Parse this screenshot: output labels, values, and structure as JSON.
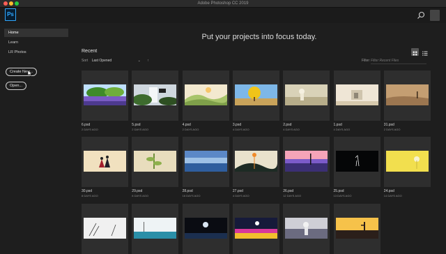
{
  "window": {
    "title": "Adobe Photoshop CC 2019",
    "traffic_lights": [
      "#fe5f57",
      "#febc2e",
      "#28c840"
    ]
  },
  "app": {
    "logo_text": "Ps",
    "accent": "#31a8ff"
  },
  "sidebar": {
    "items": [
      {
        "label": "Home",
        "active": true
      },
      {
        "label": "Learn"
      },
      {
        "label": "LR Photos"
      }
    ],
    "create_new": "Create New...",
    "open": "Open..."
  },
  "main": {
    "headline": "Put your projects into focus today.",
    "recent_title": "Recent",
    "sort_label": "Sort",
    "sort_value": "Last Opened",
    "filter_label": "Filter",
    "filter_placeholder": "Filter Recent Files"
  },
  "files": [
    {
      "name": "6.psd",
      "date": "2 DAYS AGO",
      "theme": "meadow"
    },
    {
      "name": "5.psd",
      "date": "2 DAYS AGO",
      "theme": "waterfall"
    },
    {
      "name": "4.psd",
      "date": "2 DAYS AGO",
      "theme": "hills"
    },
    {
      "name": "3.psd",
      "date": "4 DAYS AGO",
      "theme": "tree"
    },
    {
      "name": "2.psd",
      "date": "4 DAYS AGO",
      "theme": "figure"
    },
    {
      "name": "1.psd",
      "date": "4 DAYS AGO",
      "theme": "room"
    },
    {
      "name": "31.psd",
      "date": "2 DAYS AGO",
      "theme": "sepia"
    },
    {
      "name": "30.psd",
      "date": "8 DAYS AGO",
      "theme": "couple"
    },
    {
      "name": "29.psd",
      "date": "8 DAYS AGO",
      "theme": "plant"
    },
    {
      "name": "28.psd",
      "date": "16 DAYS AGO",
      "theme": "lake"
    },
    {
      "name": "27.psd",
      "date": "4 DAYS AGO",
      "theme": "moon"
    },
    {
      "name": "26.psd",
      "date": "12 DAYS AGO",
      "theme": "sunset"
    },
    {
      "name": "25.psd",
      "date": "13 DAYS AGO",
      "theme": "night"
    },
    {
      "name": "24.psd",
      "date": "14 DAYS AGO",
      "theme": "yellow"
    },
    {
      "theme": "snow"
    },
    {
      "theme": "sky"
    },
    {
      "theme": "planet"
    },
    {
      "theme": "cosmic"
    },
    {
      "theme": "girl"
    },
    {
      "theme": "cactus"
    }
  ]
}
